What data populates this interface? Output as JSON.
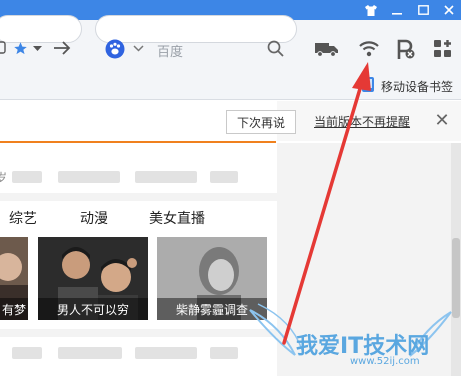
{
  "window": {
    "skin_icon": "shirt-icon",
    "minimize_icon": "minimize-icon",
    "maximize_icon": "maximize-icon"
  },
  "toolbar": {
    "search_engine": "百度",
    "mobile_bookmarks_label": "移动设备书签",
    "icons": [
      "star-icon",
      "chevron-down-icon",
      "forward-arrow-icon",
      "paw-icon",
      "search-icon",
      "truck-icon",
      "wifi-icon",
      "ad-block-icon",
      "extensions-grid-icon",
      "phone-icon"
    ]
  },
  "notice": {
    "later_button": "下次再说",
    "dont_remind_link": "当前版本不再提醒",
    "close": "✕"
  },
  "content": {
    "tabs": [
      "综艺",
      "动漫",
      "美女直播"
    ],
    "thumbnails": [
      {
        "caption": "有梦"
      },
      {
        "caption": "男人不可以穷"
      },
      {
        "caption": "柴静雾霾调查"
      }
    ],
    "cut_text": "岁"
  },
  "watermark": {
    "title": "我爱IT技术网",
    "url": "www.52ij.com"
  },
  "colors": {
    "titlebar": "#3d86e6",
    "accent_orange": "#f0811e",
    "arrow_red": "#e53935"
  }
}
